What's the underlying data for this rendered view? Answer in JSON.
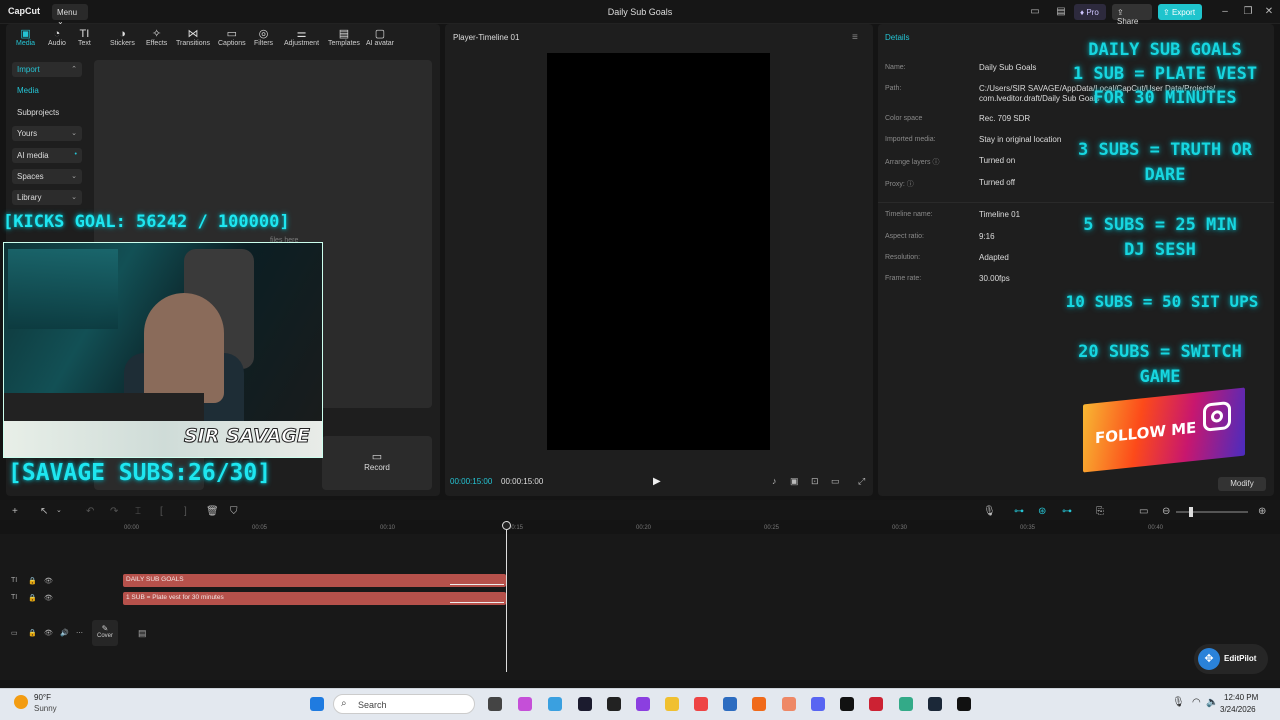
{
  "titlebar": {
    "logo": "CapCut",
    "menu_label": "Menu",
    "title": "Daily Sub Goals",
    "pro_label": "Pro",
    "share_label": "Share",
    "export_label": "Export"
  },
  "toolbar_tabs": [
    {
      "label": "Media",
      "icon": "media-icon",
      "glyph": "▣"
    },
    {
      "label": "Audio",
      "icon": "audio-icon",
      "glyph": "◔"
    },
    {
      "label": "Text",
      "icon": "text-icon",
      "glyph": "TI"
    },
    {
      "label": "Stickers",
      "icon": "stickers-icon",
      "glyph": "◑"
    },
    {
      "label": "Effects",
      "icon": "effects-icon",
      "glyph": "✧"
    },
    {
      "label": "Transitions",
      "icon": "transitions-icon",
      "glyph": "⋈"
    },
    {
      "label": "Captions",
      "icon": "captions-icon",
      "glyph": "▭"
    },
    {
      "label": "Filters",
      "icon": "filters-icon",
      "glyph": "◎"
    },
    {
      "label": "Adjustment",
      "icon": "adjustment-icon",
      "glyph": "⚌"
    },
    {
      "label": "Templates",
      "icon": "templates-icon",
      "glyph": "▤"
    },
    {
      "label": "AI avatar",
      "icon": "ai-avatar-icon",
      "glyph": "▢"
    }
  ],
  "side_nav": {
    "import": "Import",
    "media": "Media",
    "subprojects": "Subprojects",
    "yours": "Yours",
    "ai_media": "AI media",
    "spaces": "Spaces",
    "library": "Library"
  },
  "import_hint": "files here",
  "record_label": "Record",
  "stream_overlay": {
    "kicks_goal": "[KICKS GOAL: 56242 / 100000]",
    "savage_subs": "[SAVAGE SUBS:26/30]",
    "banner_text": "SIR SAVAGE"
  },
  "player": {
    "title": "Player-Timeline 01",
    "time_current": "00:00:15:00",
    "time_total": "00:00:15:00"
  },
  "details": {
    "title": "Details",
    "rows": [
      {
        "label": "Name:",
        "value": "Daily Sub Goals"
      },
      {
        "label": "Path:",
        "value": "C:/Users/SIR SAVAGE/AppData/Local/CapCut/User Data/Projects/"
      },
      {
        "label": "",
        "value": "com.lveditor.draft/Daily Sub Goals"
      },
      {
        "label": "Color space",
        "value": "Rec. 709 SDR"
      },
      {
        "label": "Imported media:",
        "value": "Stay in original location"
      },
      {
        "label": "Arrange layers",
        "value": "Turned on"
      },
      {
        "label": "Proxy:",
        "value": "Turned off"
      },
      {
        "label": "Timeline name:",
        "value": "Timeline 01"
      },
      {
        "label": "Aspect ratio:",
        "value": "9:16"
      },
      {
        "label": "Resolution:",
        "value": "Adapted"
      },
      {
        "label": "Frame rate:",
        "value": "30.00fps"
      }
    ],
    "modify_label": "Modify"
  },
  "goals_overlay": {
    "title": "DAILY SUB GOALS",
    "goal1_line1": "1 SUB = PLATE VEST",
    "goal1_line2": "FOR 30 MINUTES",
    "goal2_line1": "3 SUBS = TRUTH OR",
    "goal2_line2": "DARE",
    "goal3_line1": "5 SUBS = 25 MIN",
    "goal3_line2": "DJ SESH",
    "goal4": "10 SUBS = 50 SIT UPS",
    "goal5_line1": "20 SUBS = SWITCH",
    "goal5_line2": "GAME",
    "follow_text": "FOLLOW ME"
  },
  "timeline": {
    "ticks": [
      "00:00",
      "00:05",
      "00:10",
      "00:15",
      "00:20",
      "00:25",
      "00:30",
      "00:35",
      "00:40"
    ],
    "clip1": "DAILY SUB GOALS",
    "clip2": "1 SUB = Plate vest for 30 minutes",
    "cover_label": "Cover",
    "editpilot_label": "EditPilot"
  },
  "taskbar": {
    "weather_temp": "90°F",
    "weather_cond": "Sunny",
    "search_placeholder": "Search",
    "time": "12:40 PM",
    "date": "3/24/2026"
  }
}
